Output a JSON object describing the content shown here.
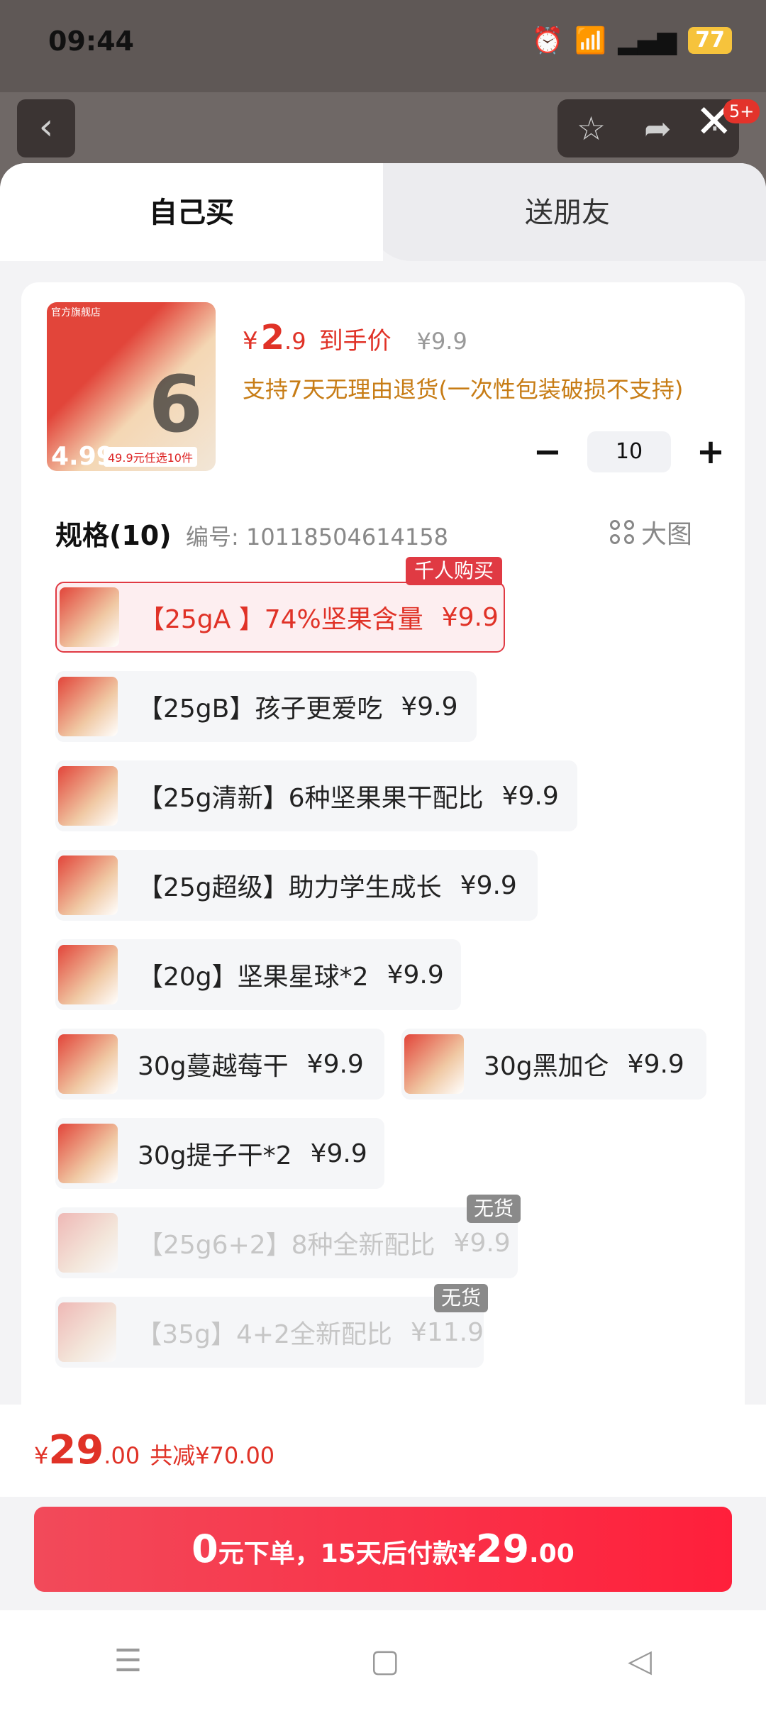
{
  "status_bar": {
    "time": "09:44",
    "battery": "77"
  },
  "header": {
    "badge": "5+"
  },
  "tabs": {
    "self": "自己买",
    "gift": "送朋友"
  },
  "product": {
    "price_currency": "¥",
    "price_int": "2",
    "price_dec": ".9",
    "price_label": "到手价",
    "original_price": "¥9.9",
    "returns": "支持7天无理由退货(一次性包装破损不支持)",
    "image_store_tag": "官方旗舰店",
    "image_big_number": "6",
    "image_price": "4.99",
    "image_strip": "49.9元任选10件"
  },
  "quantity": {
    "minus": "−",
    "value": "10",
    "plus": "+"
  },
  "spec": {
    "title": "规格(10)",
    "code": "编号: 10118504614158",
    "big_image": "大图"
  },
  "options": [
    {
      "label": "【25gA 】74%坚果含量",
      "price": "¥9.9",
      "badge": "千人购买"
    },
    {
      "label": "【25gB】孩子更爱吃",
      "price": "¥9.9"
    },
    {
      "label": "【25g清新】6种坚果果干配比",
      "price": "¥9.9"
    },
    {
      "label": "【25g超级】助力学生成长",
      "price": "¥9.9"
    },
    {
      "label": "【20g】坚果星球*2",
      "price": "¥9.9"
    },
    {
      "label": "30g蔓越莓干",
      "price": "¥9.9"
    },
    {
      "label": "30g黑加仑",
      "price": "¥9.9"
    },
    {
      "label": "30g提子干*2",
      "price": "¥9.9"
    },
    {
      "label": "【25g6+2】8种全新配比",
      "price": "¥9.9",
      "badge": "无货"
    },
    {
      "label": "【35g】4+2全新配比",
      "price": "¥11.9",
      "badge": "无货"
    }
  ],
  "total": {
    "currency": "¥",
    "int": "29",
    "dec": ".00",
    "saving": "共减¥70.00"
  },
  "pay_button": {
    "part1": "0",
    "part2": "元下单，15天后付款¥",
    "part3": "29",
    "part4": ".00"
  },
  "colors": {
    "accent": "#e03227",
    "button": "#ff1f3b"
  }
}
